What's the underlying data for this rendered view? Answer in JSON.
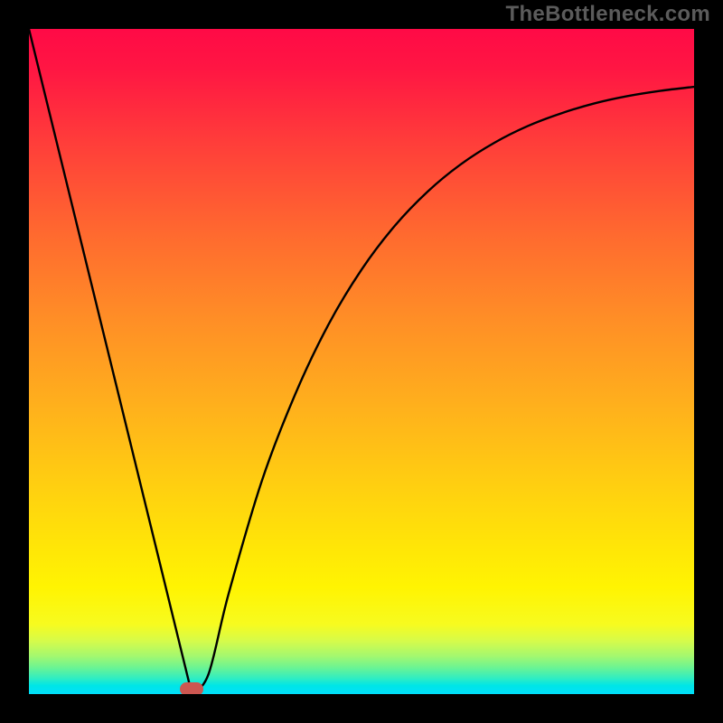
{
  "watermark": "TheBottleneck.com",
  "chart_data": {
    "type": "line",
    "title": "",
    "xlabel": "",
    "ylabel": "",
    "xlim": [
      0,
      100
    ],
    "ylim": [
      0,
      100
    ],
    "grid": false,
    "legend": false,
    "series": [
      {
        "name": "bottleneck-curve",
        "x": [
          0,
          5,
          10,
          15,
          20,
          24.5,
          27,
          30,
          35,
          40,
          45,
          50,
          55,
          60,
          65,
          70,
          75,
          80,
          85,
          90,
          95,
          100
        ],
        "y": [
          100,
          79.6,
          59.2,
          38.8,
          18.4,
          0,
          3,
          15,
          32,
          45,
          55.5,
          63.8,
          70.4,
          75.6,
          79.7,
          82.9,
          85.4,
          87.3,
          88.8,
          89.9,
          90.7,
          91.3
        ]
      }
    ],
    "marker": {
      "x": 24.5,
      "y": 0.8,
      "color": "#cd5751"
    },
    "gradient_stops": [
      {
        "pos": 0.0,
        "color": "#ff0a46"
      },
      {
        "pos": 0.17,
        "color": "#ff3d3a"
      },
      {
        "pos": 0.44,
        "color": "#ff8f26"
      },
      {
        "pos": 0.69,
        "color": "#ffd010"
      },
      {
        "pos": 0.84,
        "color": "#fff402"
      },
      {
        "pos": 0.94,
        "color": "#a3f86f"
      },
      {
        "pos": 1.0,
        "color": "#00dffb"
      }
    ]
  }
}
